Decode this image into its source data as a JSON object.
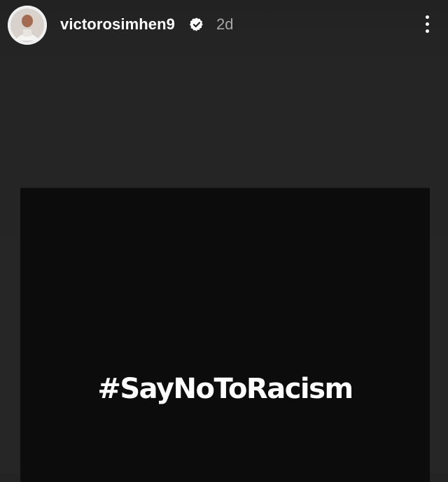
{
  "story": {
    "header": {
      "avatar_icon": "profile-avatar-icon",
      "username": "victorosimhen9",
      "verified_icon": "verified-badge-icon",
      "timestamp": "2d",
      "more_icon": "more-vertical-icon"
    },
    "media": {
      "text": "#SayNoToRacism",
      "background_color": "#0c0c0c",
      "text_color": "#ffffff"
    }
  }
}
